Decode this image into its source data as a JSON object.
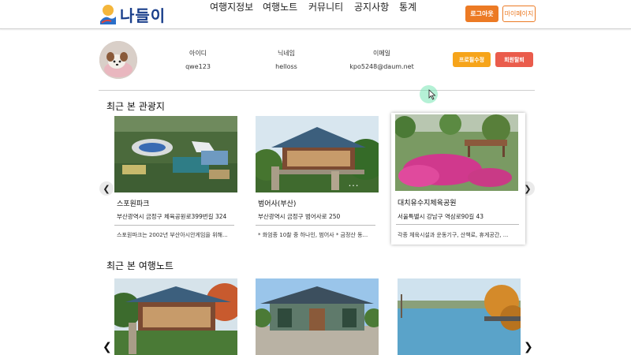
{
  "header": {
    "logo_text": "나들이",
    "nav": [
      "여행지정보",
      "여행노트",
      "커뮤니티",
      "공지사항",
      "통계"
    ],
    "logout_label": "로그아웃",
    "mypage_label": "마이페이지"
  },
  "profile": {
    "id_label": "아이디",
    "id_value": "qwe123",
    "nickname_label": "닉네임",
    "nickname_value": "helloss",
    "email_label": "이메일",
    "email_value": "kpo5248@daum.net",
    "edit_label": "프로필수정",
    "withdraw_label": "회원탈퇴"
  },
  "recent_spots": {
    "title": "최근 본 관광지",
    "cards": [
      {
        "title": "스포원파크",
        "address": "부산광역시 금정구 체육공원로399번길 324",
        "desc": "스포원파크는 2002년 부산아시안게임을 위해..."
      },
      {
        "title": "범어사(부산)",
        "address": "부산광역시 금정구 범어사로 250",
        "desc": "* 화엄종 10찰 중 하나인, 범어사 * 금정산 동..."
      },
      {
        "title": "대치유수지체육공원",
        "address": "서울특별시 강남구 역삼로90길 43",
        "desc": "각종 체육시설과 운동기구, 산책로, 휴게공간, ..."
      }
    ]
  },
  "recent_notes": {
    "title": "최근 본 여행노트"
  },
  "icons": {
    "prev": "chevron-left-icon",
    "next": "chevron-right-icon",
    "cursor": "mouse-pointer-icon"
  },
  "colors": {
    "accent_orange": "#ec7a24",
    "edit_yellow": "#f6a41a",
    "withdraw_red": "#ea5c4c"
  }
}
